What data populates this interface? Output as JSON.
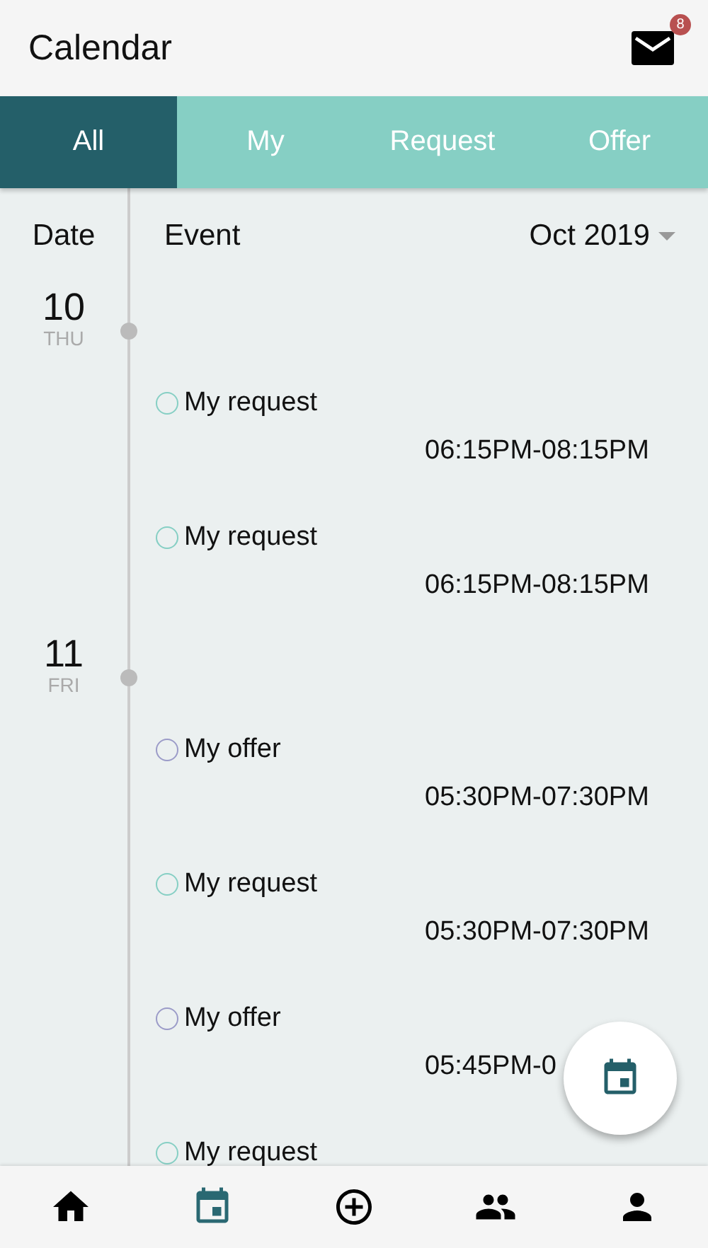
{
  "app_bar": {
    "title": "Calendar",
    "mail_badge": "8"
  },
  "tabs": [
    {
      "label": "All",
      "selected": true
    },
    {
      "label": "My",
      "selected": false
    },
    {
      "label": "Request",
      "selected": false
    },
    {
      "label": "Offer",
      "selected": false
    }
  ],
  "list_header": {
    "date": "Date",
    "event": "Event",
    "month": "Oct 2019"
  },
  "days": [
    {
      "day": "10",
      "weekday": "THU",
      "events": [
        {
          "title": "My request",
          "time": "06:15PM-08:15PM",
          "color": "#86cfc4"
        },
        {
          "title": "My request",
          "time": "06:15PM-08:15PM",
          "color": "#86cfc4"
        }
      ]
    },
    {
      "day": "11",
      "weekday": "FRI",
      "events": [
        {
          "title": "My offer",
          "time": "05:30PM-07:30PM",
          "color": "#9b9bc8"
        },
        {
          "title": "My request",
          "time": "05:30PM-07:30PM",
          "color": "#86cfc4"
        },
        {
          "title": "My offer",
          "time": "05:45PM-0",
          "color": "#9b9bc8"
        },
        {
          "title": "My request",
          "color": "#86cfc4"
        }
      ]
    }
  ],
  "bottom_nav": [
    {
      "kind": "home",
      "selected": false
    },
    {
      "kind": "calendar",
      "selected": true
    },
    {
      "kind": "add",
      "selected": false
    },
    {
      "kind": "people",
      "selected": false
    },
    {
      "kind": "person",
      "selected": false
    }
  ]
}
